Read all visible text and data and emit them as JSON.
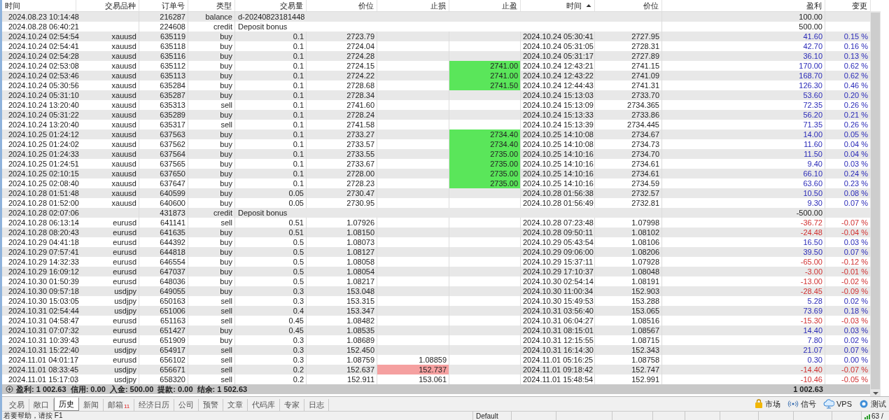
{
  "columns": [
    {
      "label": "时间",
      "sorted": false
    },
    {
      "label": "交易品种",
      "sorted": false
    },
    {
      "label": "订单号",
      "sorted": false
    },
    {
      "label": "类型",
      "sorted": false
    },
    {
      "label": "交易量",
      "sorted": false
    },
    {
      "label": "价位",
      "sorted": false
    },
    {
      "label": "止损",
      "sorted": false
    },
    {
      "label": "止盈",
      "sorted": false
    },
    {
      "label": "时间",
      "sorted": true
    },
    {
      "label": "价位",
      "sorted": false
    },
    {
      "label": "盈利",
      "sorted": false
    },
    {
      "label": "变更",
      "sorted": false
    }
  ],
  "rows": [
    {
      "kind": "deposit",
      "time": "2024.08.23 10:14:48",
      "order": "216287",
      "type": "balance",
      "comment": "d-20240823181448",
      "profit": "100.00"
    },
    {
      "kind": "deposit",
      "time": "2024.08.28 06:40:21",
      "order": "224608",
      "type": "credit",
      "comment": "Deposit bonus",
      "profit": "500.00"
    },
    {
      "kind": "buy",
      "time": "2024.10.24 02:54:54",
      "symbol": "xauusd",
      "order": "635119",
      "type": "buy",
      "volume": "0.1",
      "price": "2723.79",
      "close_time": "2024.10.24 05:30:41",
      "close_price": "2727.95",
      "profit": "41.60",
      "change": "0.15 %",
      "loss": false,
      "sl_hit": false,
      "tp_hit": false
    },
    {
      "kind": "buy",
      "time": "2024.10.24 02:54:41",
      "symbol": "xauusd",
      "order": "635118",
      "type": "buy",
      "volume": "0.1",
      "price": "2724.04",
      "close_time": "2024.10.24 05:31:05",
      "close_price": "2728.31",
      "profit": "42.70",
      "change": "0.16 %",
      "loss": false,
      "sl_hit": false,
      "tp_hit": false
    },
    {
      "kind": "buy",
      "time": "2024.10.24 02:54:28",
      "symbol": "xauusd",
      "order": "635116",
      "type": "buy",
      "volume": "0.1",
      "price": "2724.28",
      "close_time": "2024.10.24 05:31:17",
      "close_price": "2727.89",
      "profit": "36.10",
      "change": "0.13 %",
      "loss": false,
      "sl_hit": false,
      "tp_hit": false
    },
    {
      "kind": "buy",
      "time": "2024.10.24 02:53:08",
      "symbol": "xauusd",
      "order": "635112",
      "type": "buy",
      "volume": "0.1",
      "price": "2724.15",
      "take_profit": "2741.00",
      "close_time": "2024.10.24 12:43:21",
      "close_price": "2741.15",
      "profit": "170.00",
      "change": "0.62 %",
      "loss": false,
      "sl_hit": false,
      "tp_hit": true
    },
    {
      "kind": "buy",
      "time": "2024.10.24 02:53:46",
      "symbol": "xauusd",
      "order": "635113",
      "type": "buy",
      "volume": "0.1",
      "price": "2724.22",
      "take_profit": "2741.00",
      "close_time": "2024.10.24 12:43:22",
      "close_price": "2741.09",
      "profit": "168.70",
      "change": "0.62 %",
      "loss": false,
      "sl_hit": false,
      "tp_hit": true
    },
    {
      "kind": "buy",
      "time": "2024.10.24 05:30:56",
      "symbol": "xauusd",
      "order": "635284",
      "type": "buy",
      "volume": "0.1",
      "price": "2728.68",
      "take_profit": "2741.50",
      "close_time": "2024.10.24 12:44:43",
      "close_price": "2741.31",
      "profit": "126.30",
      "change": "0.46 %",
      "loss": false,
      "sl_hit": false,
      "tp_hit": true
    },
    {
      "kind": "buy",
      "time": "2024.10.24 05:31:10",
      "symbol": "xauusd",
      "order": "635287",
      "type": "buy",
      "volume": "0.1",
      "price": "2728.34",
      "close_time": "2024.10.24 15:13:03",
      "close_price": "2733.70",
      "profit": "53.60",
      "change": "0.20 %",
      "loss": false,
      "sl_hit": false,
      "tp_hit": false
    },
    {
      "kind": "sell",
      "time": "2024.10.24 13:20:40",
      "symbol": "xauusd",
      "order": "635313",
      "type": "sell",
      "volume": "0.1",
      "price": "2741.60",
      "close_time": "2024.10.24 15:13:09",
      "close_price": "2734.365",
      "profit": "72.35",
      "change": "0.26 %",
      "loss": false,
      "sl_hit": false,
      "tp_hit": false
    },
    {
      "kind": "buy",
      "time": "2024.10.24 05:31:22",
      "symbol": "xauusd",
      "order": "635289",
      "type": "buy",
      "volume": "0.1",
      "price": "2728.24",
      "close_time": "2024.10.24 15:13:33",
      "close_price": "2733.86",
      "profit": "56.20",
      "change": "0.21 %",
      "loss": false,
      "sl_hit": false,
      "tp_hit": false
    },
    {
      "kind": "sell",
      "time": "2024.10.24 13:20:40",
      "symbol": "xauusd",
      "order": "635317",
      "type": "sell",
      "volume": "0.1",
      "price": "2741.58",
      "close_time": "2024.10.24 15:13:39",
      "close_price": "2734.445",
      "profit": "71.35",
      "change": "0.26 %",
      "loss": false,
      "sl_hit": false,
      "tp_hit": false
    },
    {
      "kind": "buy",
      "time": "2024.10.25 01:24:12",
      "symbol": "xauusd",
      "order": "637563",
      "type": "buy",
      "volume": "0.1",
      "price": "2733.27",
      "take_profit": "2734.40",
      "close_time": "2024.10.25 14:10:08",
      "close_price": "2734.67",
      "profit": "14.00",
      "change": "0.05 %",
      "loss": false,
      "sl_hit": false,
      "tp_hit": true
    },
    {
      "kind": "buy",
      "time": "2024.10.25 01:24:02",
      "symbol": "xauusd",
      "order": "637562",
      "type": "buy",
      "volume": "0.1",
      "price": "2733.57",
      "take_profit": "2734.40",
      "close_time": "2024.10.25 14:10:08",
      "close_price": "2734.73",
      "profit": "11.60",
      "change": "0.04 %",
      "loss": false,
      "sl_hit": false,
      "tp_hit": true
    },
    {
      "kind": "buy",
      "time": "2024.10.25 01:24:33",
      "symbol": "xauusd",
      "order": "637564",
      "type": "buy",
      "volume": "0.1",
      "price": "2733.55",
      "take_profit": "2735.00",
      "close_time": "2024.10.25 14:10:16",
      "close_price": "2734.70",
      "profit": "11.50",
      "change": "0.04 %",
      "loss": false,
      "sl_hit": false,
      "tp_hit": true
    },
    {
      "kind": "buy",
      "time": "2024.10.25 01:24:51",
      "symbol": "xauusd",
      "order": "637565",
      "type": "buy",
      "volume": "0.1",
      "price": "2733.67",
      "take_profit": "2735.00",
      "close_time": "2024.10.25 14:10:16",
      "close_price": "2734.61",
      "profit": "9.40",
      "change": "0.03 %",
      "loss": false,
      "sl_hit": false,
      "tp_hit": true
    },
    {
      "kind": "buy",
      "time": "2024.10.25 02:10:15",
      "symbol": "xauusd",
      "order": "637650",
      "type": "buy",
      "volume": "0.1",
      "price": "2728.00",
      "take_profit": "2735.00",
      "close_time": "2024.10.25 14:10:16",
      "close_price": "2734.61",
      "profit": "66.10",
      "change": "0.24 %",
      "loss": false,
      "sl_hit": false,
      "tp_hit": true
    },
    {
      "kind": "buy",
      "time": "2024.10.25 02:08:40",
      "symbol": "xauusd",
      "order": "637647",
      "type": "buy",
      "volume": "0.1",
      "price": "2728.23",
      "take_profit": "2735.00",
      "close_time": "2024.10.25 14:10:16",
      "close_price": "2734.59",
      "profit": "63.60",
      "change": "0.23 %",
      "loss": false,
      "sl_hit": false,
      "tp_hit": true
    },
    {
      "kind": "buy",
      "time": "2024.10.28 01:51:48",
      "symbol": "xauusd",
      "order": "640599",
      "type": "buy",
      "volume": "0.05",
      "price": "2730.47",
      "close_time": "2024.10.28 01:56:38",
      "close_price": "2732.57",
      "profit": "10.50",
      "change": "0.08 %",
      "loss": false,
      "sl_hit": false,
      "tp_hit": false
    },
    {
      "kind": "buy",
      "time": "2024.10.28 01:52:00",
      "symbol": "xauusd",
      "order": "640600",
      "type": "buy",
      "volume": "0.05",
      "price": "2730.95",
      "close_time": "2024.10.28 01:56:49",
      "close_price": "2732.81",
      "profit": "9.30",
      "change": "0.07 %",
      "loss": false,
      "sl_hit": false,
      "tp_hit": false
    },
    {
      "kind": "withdrawal",
      "time": "2024.10.28 02:07:06",
      "order": "431873",
      "type": "credit",
      "comment": "Deposit bonus",
      "profit": "-500.00"
    },
    {
      "kind": "sell",
      "time": "2024.10.28 06:13:14",
      "symbol": "eurusd",
      "order": "641141",
      "type": "sell",
      "volume": "0.51",
      "price": "1.07926",
      "close_time": "2024.10.28 07:23:48",
      "close_price": "1.07998",
      "profit": "-36.72",
      "change": "-0.07 %",
      "loss": true,
      "sl_hit": false,
      "tp_hit": false
    },
    {
      "kind": "buy",
      "time": "2024.10.28 08:20:43",
      "symbol": "eurusd",
      "order": "641635",
      "type": "buy",
      "volume": "0.51",
      "price": "1.08150",
      "close_time": "2024.10.28 09:50:11",
      "close_price": "1.08102",
      "profit": "-24.48",
      "change": "-0.04 %",
      "loss": true,
      "sl_hit": false,
      "tp_hit": false
    },
    {
      "kind": "buy",
      "time": "2024.10.29 04:41:18",
      "symbol": "eurusd",
      "order": "644392",
      "type": "buy",
      "volume": "0.5",
      "price": "1.08073",
      "close_time": "2024.10.29 05:43:54",
      "close_price": "1.08106",
      "profit": "16.50",
      "change": "0.03 %",
      "loss": false,
      "sl_hit": false,
      "tp_hit": false
    },
    {
      "kind": "buy",
      "time": "2024.10.29 07:57:41",
      "symbol": "eurusd",
      "order": "644818",
      "type": "buy",
      "volume": "0.5",
      "price": "1.08127",
      "close_time": "2024.10.29 09:06:00",
      "close_price": "1.08206",
      "profit": "39.50",
      "change": "0.07 %",
      "loss": false,
      "sl_hit": false,
      "tp_hit": false
    },
    {
      "kind": "buy",
      "time": "2024.10.29 14:32:33",
      "symbol": "eurusd",
      "order": "646554",
      "type": "buy",
      "volume": "0.5",
      "price": "1.08058",
      "close_time": "2024.10.29 15:37:11",
      "close_price": "1.07928",
      "profit": "-65.00",
      "change": "-0.12 %",
      "loss": true,
      "sl_hit": false,
      "tp_hit": false
    },
    {
      "kind": "buy",
      "time": "2024.10.29 16:09:12",
      "symbol": "eurusd",
      "order": "647037",
      "type": "buy",
      "volume": "0.5",
      "price": "1.08054",
      "close_time": "2024.10.29 17:10:37",
      "close_price": "1.08048",
      "profit": "-3.00",
      "change": "-0.01 %",
      "loss": true,
      "sl_hit": false,
      "tp_hit": false
    },
    {
      "kind": "buy",
      "time": "2024.10.30 01:50:39",
      "symbol": "eurusd",
      "order": "648036",
      "type": "buy",
      "volume": "0.5",
      "price": "1.08217",
      "close_time": "2024.10.30 02:54:14",
      "close_price": "1.08191",
      "profit": "-13.00",
      "change": "-0.02 %",
      "loss": true,
      "sl_hit": false,
      "tp_hit": false
    },
    {
      "kind": "buy",
      "time": "2024.10.30 09:57:18",
      "symbol": "usdjpy",
      "order": "649055",
      "type": "buy",
      "volume": "0.3",
      "price": "153.048",
      "close_time": "2024.10.30 11:00:34",
      "close_price": "152.903",
      "profit": "-28.45",
      "change": "-0.09 %",
      "loss": true,
      "sl_hit": false,
      "tp_hit": false
    },
    {
      "kind": "sell",
      "time": "2024.10.30 15:03:05",
      "symbol": "usdjpy",
      "order": "650163",
      "type": "sell",
      "volume": "0.3",
      "price": "153.315",
      "close_time": "2024.10.30 15:49:53",
      "close_price": "153.288",
      "profit": "5.28",
      "change": "0.02 %",
      "loss": false,
      "sl_hit": false,
      "tp_hit": false
    },
    {
      "kind": "sell",
      "time": "2024.10.31 02:54:44",
      "symbol": "usdjpy",
      "order": "651006",
      "type": "sell",
      "volume": "0.4",
      "price": "153.347",
      "close_time": "2024.10.31 03:56:40",
      "close_price": "153.065",
      "profit": "73.69",
      "change": "0.18 %",
      "loss": false,
      "sl_hit": false,
      "tp_hit": false
    },
    {
      "kind": "sell",
      "time": "2024.10.31 04:58:47",
      "symbol": "eurusd",
      "order": "651163",
      "type": "sell",
      "volume": "0.45",
      "price": "1.08482",
      "close_time": "2024.10.31 06:04:27",
      "close_price": "1.08516",
      "profit": "-15.30",
      "change": "-0.03 %",
      "loss": true,
      "sl_hit": false,
      "tp_hit": false
    },
    {
      "kind": "buy",
      "time": "2024.10.31 07:07:32",
      "symbol": "eurusd",
      "order": "651427",
      "type": "buy",
      "volume": "0.45",
      "price": "1.08535",
      "close_time": "2024.10.31 08:15:01",
      "close_price": "1.08567",
      "profit": "14.40",
      "change": "0.03 %",
      "loss": false,
      "sl_hit": false,
      "tp_hit": false
    },
    {
      "kind": "buy",
      "time": "2024.10.31 10:39:43",
      "symbol": "eurusd",
      "order": "651909",
      "type": "buy",
      "volume": "0.3",
      "price": "1.08689",
      "close_time": "2024.10.31 12:15:55",
      "close_price": "1.08715",
      "profit": "7.80",
      "change": "0.02 %",
      "loss": false,
      "sl_hit": false,
      "tp_hit": false
    },
    {
      "kind": "sell",
      "time": "2024.10.31 15:22:40",
      "symbol": "usdjpy",
      "order": "654917",
      "type": "sell",
      "volume": "0.3",
      "price": "152.450",
      "close_time": "2024.10.31 16:14:30",
      "close_price": "152.343",
      "profit": "21.07",
      "change": "0.07 %",
      "loss": false,
      "sl_hit": false,
      "tp_hit": false
    },
    {
      "kind": "sell",
      "time": "2024.11.01 04:01:17",
      "symbol": "eurusd",
      "order": "656102",
      "type": "sell",
      "volume": "0.3",
      "price": "1.08759",
      "stop_loss": "1.08859",
      "close_time": "2024.11.01 05:16:25",
      "close_price": "1.08758",
      "profit": "0.30",
      "change": "0.00 %",
      "loss": false,
      "sl_hit": false,
      "tp_hit": false
    },
    {
      "kind": "sell",
      "time": "2024.11.01 08:33:45",
      "symbol": "usdjpy",
      "order": "656671",
      "type": "sell",
      "volume": "0.2",
      "price": "152.637",
      "stop_loss": "152.737",
      "close_time": "2024.11.01 09:18:42",
      "close_price": "152.747",
      "profit": "-14.40",
      "change": "-0.07 %",
      "loss": true,
      "sl_hit": true,
      "tp_hit": false
    },
    {
      "kind": "sell",
      "time": "2024.11.01 15:17:03",
      "symbol": "usdjpy",
      "order": "658320",
      "type": "sell",
      "volume": "0.2",
      "price": "152.911",
      "stop_loss": "153.061",
      "close_time": "2024.11.01 15:48:54",
      "close_price": "152.991",
      "profit": "-10.46",
      "change": "-0.05 %",
      "loss": true,
      "sl_hit": false,
      "tp_hit": false
    }
  ],
  "summary": {
    "text": "盈利: 1 002.63  信用: 0.00  入金: 500.00  提款: 0.00  结余: 1 502.63",
    "profit": "1 002.63"
  },
  "tabs": [
    {
      "label": "交易",
      "selected": false
    },
    {
      "label": "敞口",
      "selected": false
    },
    {
      "label": "历史",
      "selected": true
    },
    {
      "label": "新闻",
      "selected": false
    },
    {
      "label": "邮箱",
      "badge": "11",
      "selected": false
    },
    {
      "label": "经济日历",
      "selected": false
    },
    {
      "label": "公司",
      "selected": false
    },
    {
      "label": "预警",
      "selected": false
    },
    {
      "label": "文章",
      "selected": false
    },
    {
      "label": "代码库",
      "selected": false
    },
    {
      "label": "专家",
      "selected": false
    },
    {
      "label": "日志",
      "selected": false
    }
  ],
  "tools": [
    {
      "kind": "market",
      "label": "市场"
    },
    {
      "kind": "signals",
      "label": "信号"
    },
    {
      "kind": "vps",
      "label": "VPS"
    },
    {
      "kind": "tester",
      "label": "测试"
    }
  ],
  "status_bar": {
    "help": "若要帮助，请按 F1",
    "profile": "Default",
    "connection": "63 /"
  }
}
